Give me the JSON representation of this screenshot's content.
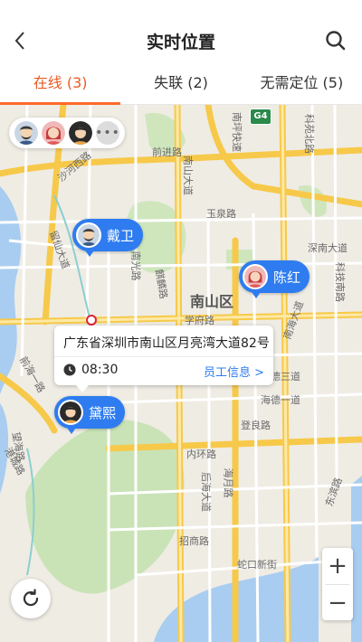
{
  "header": {
    "title": "实时位置"
  },
  "tabs": [
    {
      "label": "在线 (3)",
      "active": true
    },
    {
      "label": "失联 (2)",
      "active": false
    },
    {
      "label": "无需定位 (5)",
      "active": false
    }
  ],
  "map": {
    "district": "南山区",
    "highway_badge": "G4",
    "road_labels": [
      "科苑北路",
      "前进路",
      "南山大道",
      "南坪快速",
      "留仙大道",
      "深南大道",
      "科技南路",
      "南光路",
      "麒麟路",
      "学府路",
      "南海大道",
      "海德三道",
      "海德一道",
      "登良路",
      "内环路",
      "后海大道",
      "海月路",
      "招商路",
      "蛇口新街",
      "东滨路",
      "望海路",
      "前海一路",
      "港城路",
      "沙河西路",
      "玉泉路"
    ],
    "more_avatars": "•••",
    "markers": [
      {
        "name": "戴卫"
      },
      {
        "name": "陈红"
      },
      {
        "name": "黛熙"
      }
    ],
    "info_popup": {
      "address": "广东省深圳市南山区月亮湾大道82号",
      "time": "08:30",
      "link": "员工信息 >"
    },
    "zoom_in": "+",
    "zoom_out": "−"
  },
  "colors": {
    "accent": "#ff6a2c",
    "marker": "#2e7cf0"
  }
}
